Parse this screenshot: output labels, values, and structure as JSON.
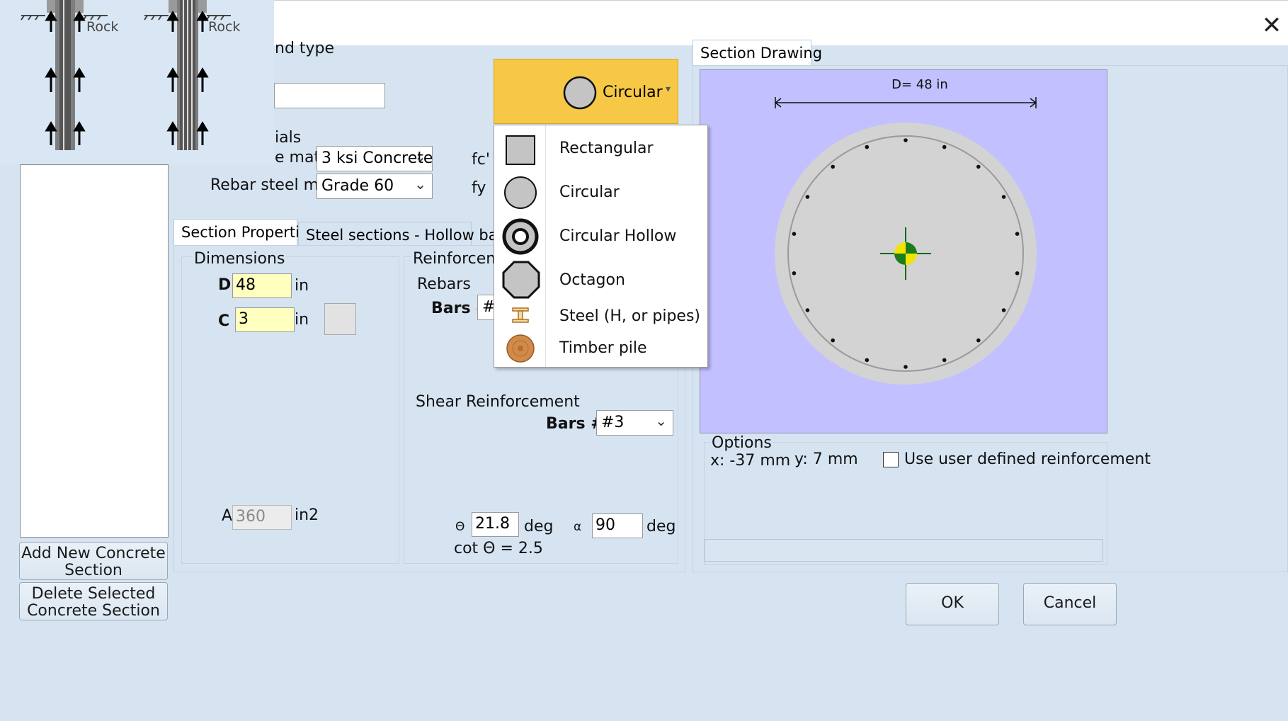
{
  "window": {
    "close_glyph": "✕"
  },
  "thumbnail": {
    "label_left": "Rock",
    "label_right": "Rock"
  },
  "top_left": {
    "section_type_label": "nd type",
    "materials_label": "ials",
    "concrete_mat_label": "e mat.",
    "concrete_mat_value": "3 ksi Concrete",
    "rebar_mat_label": "Rebar steel mat.",
    "rebar_mat_value": "Grade 60",
    "fc_label": "fc'",
    "fy_label": "fy"
  },
  "shape_button": {
    "label": "Circular",
    "icon": "circle-icon",
    "color": "#f6c845"
  },
  "shape_menu": {
    "items": [
      {
        "label": "Rectangular",
        "icon": "square-icon"
      },
      {
        "label": "Circular",
        "icon": "circle-icon"
      },
      {
        "label": "Circular Hollow",
        "icon": "hollow-circle-icon"
      },
      {
        "label": "Octagon",
        "icon": "octagon-icon"
      },
      {
        "label": "Steel (H, or pipes)",
        "icon": "steel-h-icon"
      },
      {
        "label": "Timber pile",
        "icon": "timber-icon"
      }
    ]
  },
  "left_buttons": {
    "add": "Add New Concrete Section",
    "delete": "Delete Selected Concrete Section"
  },
  "tabs": [
    "Section Properties",
    "Steel sections - Hollow bars"
  ],
  "dimensions": {
    "title": "Dimensions",
    "d_label": "D",
    "d_value": "48",
    "d_unit": "in",
    "c_label": "C",
    "c_value": "3",
    "c_unit": "in",
    "a_label": "A",
    "a_value": "360",
    "a_unit": "in2"
  },
  "reinforcement": {
    "title": "Reinforcemen",
    "rebars_label": "Rebars",
    "bars_label": "Bars #",
    "bars_value": "#",
    "shear_title": "Shear Reinforcement",
    "shear_bars_label": "Bars #",
    "shear_bars_value": "#3",
    "theta_symbol": "Θ",
    "theta_value": "21.8",
    "theta_unit": "deg",
    "alpha_symbol": "α",
    "alpha_value": "90",
    "alpha_unit": "deg",
    "cot_text": "cot Θ = 2.5"
  },
  "section_drawing": {
    "tab_label": "Section Drawing",
    "dimension_text": "D= 48 in",
    "bg_color": "#c2c0ff",
    "bar_count": 18
  },
  "options": {
    "title": "Options",
    "x_readout": "x: -37 mm",
    "y_readout": "y: 7 mm",
    "checkbox_label": "Use user defined reinforcement",
    "checked": false
  },
  "footer": {
    "ok": "OK",
    "cancel": "Cancel"
  }
}
